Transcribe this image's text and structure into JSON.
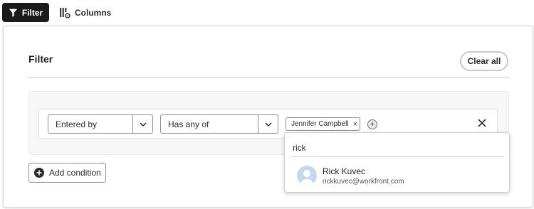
{
  "toolbar": {
    "filter_label": "Filter",
    "columns_label": "Columns"
  },
  "panel": {
    "title": "Filter",
    "clear_all_label": "Clear all",
    "add_condition_label": "Add condition"
  },
  "condition": {
    "field_value": "Entered by",
    "operator_value": "Has any of",
    "selected_values": [
      "Jennifer Campbell"
    ]
  },
  "search": {
    "value": "rick",
    "results": [
      {
        "name": "Rick Kuvec",
        "email": "rickkuvec@workfront.com"
      }
    ]
  },
  "colors": {
    "primary_dark": "#1b1b1b",
    "border": "#8e8e8e",
    "avatar_bg": "#c5d9ec"
  }
}
